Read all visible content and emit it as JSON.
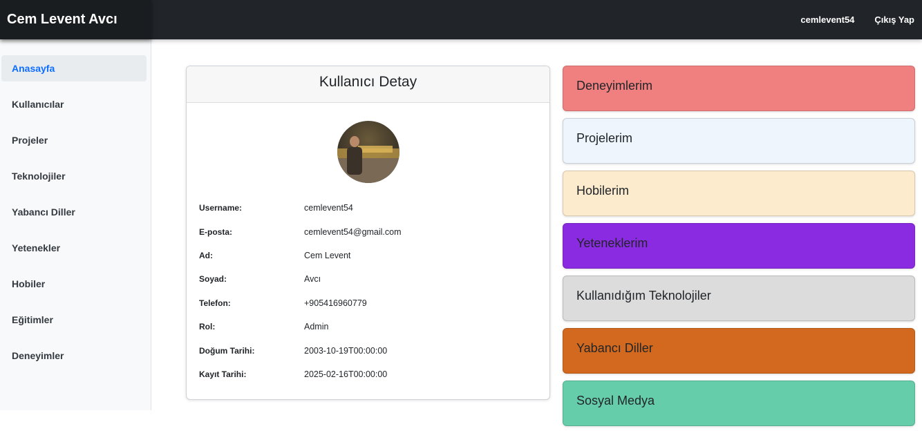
{
  "header": {
    "brand": "Cem Levent Avcı",
    "username": "cemlevent54",
    "logout_label": "Çıkış Yap"
  },
  "sidebar": {
    "items": [
      {
        "label": "Anasayfa",
        "active": true
      },
      {
        "label": "Kullanıcılar"
      },
      {
        "label": "Projeler"
      },
      {
        "label": "Teknolojiler"
      },
      {
        "label": "Yabancı Diller"
      },
      {
        "label": "Yetenekler"
      },
      {
        "label": "Hobiler"
      },
      {
        "label": "Eğitimler"
      },
      {
        "label": "Deneyimler"
      }
    ]
  },
  "user_card": {
    "title": "Kullanıcı Detay",
    "rows": [
      {
        "label": "Username:",
        "value": "cemlevent54"
      },
      {
        "label": "E-posta:",
        "value": "cemlevent54@gmail.com"
      },
      {
        "label": "Ad:",
        "value": "Cem Levent"
      },
      {
        "label": "Soyad:",
        "value": "Avcı"
      },
      {
        "label": "Telefon:",
        "value": "+905416960779"
      },
      {
        "label": "Rol:",
        "value": "Admin"
      },
      {
        "label": "Doğum Tarihi:",
        "value": "2003-10-19T00:00:00"
      },
      {
        "label": "Kayıt Tarihi:",
        "value": "2025-02-16T00:00:00"
      }
    ]
  },
  "tiles": [
    {
      "label": "Deneyimlerim",
      "color": "#f07f7f"
    },
    {
      "label": "Projelerim",
      "color": "#eef5fd"
    },
    {
      "label": "Hobilerim",
      "color": "#fdebce"
    },
    {
      "label": "Yeteneklerim",
      "color": "#8a2be2"
    },
    {
      "label": "Kullanıdığım Teknolojiler",
      "color": "#dcdcdc"
    },
    {
      "label": "Yabancı Diller",
      "color": "#d2691e"
    },
    {
      "label": "Sosyal Medya",
      "color": "#66cdaa"
    }
  ]
}
